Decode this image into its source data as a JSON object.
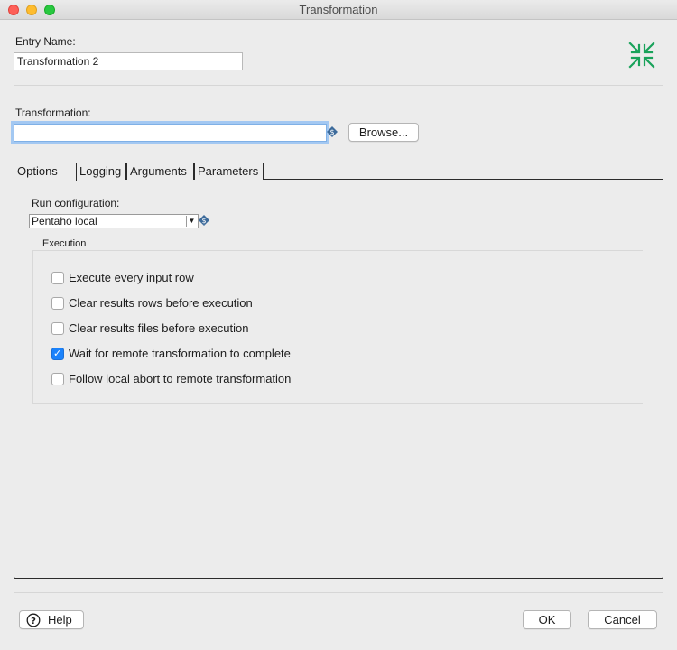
{
  "window": {
    "title": "Transformation"
  },
  "entry": {
    "label": "Entry Name:",
    "value": "Transformation 2"
  },
  "transformation": {
    "label": "Transformation:",
    "value": "",
    "browse_label": "Browse..."
  },
  "tabs": [
    {
      "label": "Options",
      "active": true
    },
    {
      "label": "Logging",
      "active": false
    },
    {
      "label": "Arguments",
      "active": false
    },
    {
      "label": "Parameters",
      "active": false
    }
  ],
  "options": {
    "run_config_label": "Run configuration:",
    "run_config_value": "Pentaho local",
    "execution_title": "Execution",
    "checks": [
      {
        "label": "Execute every input row",
        "checked": false
      },
      {
        "label": "Clear results rows before execution",
        "checked": false
      },
      {
        "label": "Clear results files before execution",
        "checked": false
      },
      {
        "label": "Wait for remote transformation to complete",
        "checked": true
      },
      {
        "label": "Follow local abort to remote transformation",
        "checked": false
      }
    ]
  },
  "footer": {
    "help_label": "Help",
    "ok_label": "OK",
    "cancel_label": "Cancel"
  },
  "colors": {
    "accent": "#1a82fb",
    "collapse_icon": "#19a25a"
  },
  "icons": {
    "collapse": "collapse-arrows-icon",
    "variable": "variable-dollar-icon",
    "help": "help-circle-icon"
  }
}
